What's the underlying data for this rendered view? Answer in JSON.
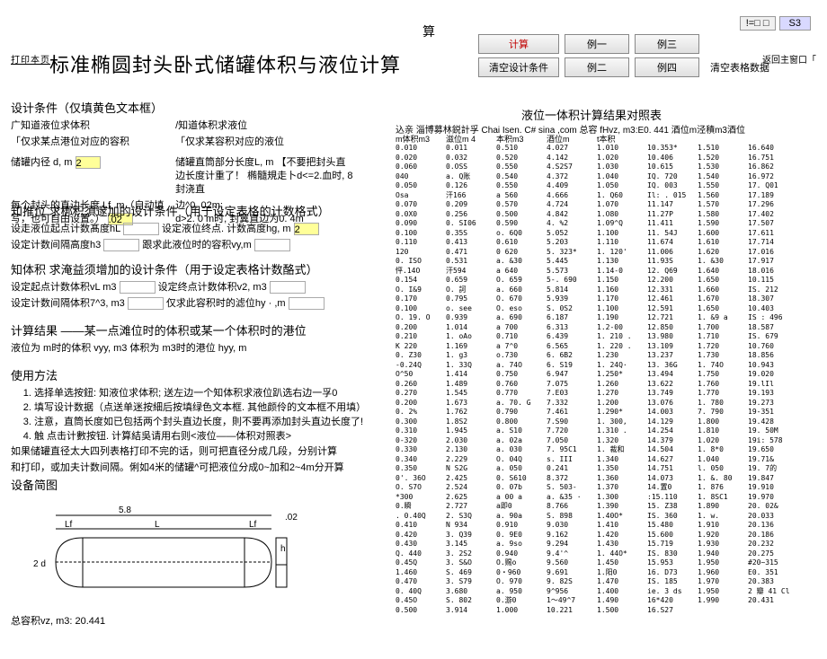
{
  "header": {
    "suan": "算",
    "flag": "!=□ □",
    "s3": "S3",
    "print": "打印本页",
    "title": "标准椭圆封头卧式储罐体积与液位计算",
    "back": "返回主窗口「"
  },
  "buttons": {
    "calc": "计算",
    "ex1": "例一",
    "ex3": "例三",
    "clr1": "清空设计条件",
    "ex2": "例二",
    "ex4": "例四",
    "clr2": "清空表格数据"
  },
  "cond": {
    "hdr": "设计条件（仅填黄色文本框）",
    "c1": "广知道液位求体积",
    "c2": "/知道体积求液位",
    "c3": "「仅求某点港位对应的容积",
    "c4": "「仅求某容积对应的液位",
    "dlabel": "储罐内径 d, m",
    "dval": "2",
    "lf_label": "每个封头的直边长度 Lf, m（自动填写，也可自由设置。）",
    "lf_val": ".02",
    "r1": "储罐直筒部分长度L, m 【不要把封头直边长度计重了！      椭髓規走卜d<=2.血时, 8封浇直",
    "r2": "边^0. 02m;",
    "r3": "d>2. 0 m时, 封翼直边为0. 4m"
  },
  "known_level": {
    "hdr": "知推位       求梆积須邃加的设计条件（用于设定表格的计数格式）",
    "l1": "设走液位起点计数髙度hL",
    "l2": "设定计数间隔高度h3",
    "r1": "设定液位终点. 计数高度hg, m",
    "r1v": "2",
    "r2": "跟求此液位时的容积vy,m"
  },
  "known_vol": {
    "hdr": "知体积      求淹益须增加的设计条件（用于设定表格计数酪式）",
    "l1": "设定起点计数体积vL m3",
    "l2": "设定计数间隔体积7^3, m3",
    "r1": "设定终点计数体积v2, m3",
    "r2": "仅求此容积时的滤位hy · ,m"
  },
  "result": {
    "hdr": "计算结果     ——某一点滩位时的体积或某一个体积时的港位",
    "row": "液位为         m时的体积 vyy, m3                   体积为         m3时的港位 hyy, m"
  },
  "usage": {
    "hdr": "使用方法",
    "i1": "选择单选按鈕: 知液位求体积; 送左边一个知体积求液位趴选右边一孚0",
    "i2": "填写设计数据（点送单迷按細后按填绿色文本框. 其他颜伶的文本框不用填）",
    "i3": "注意，直筒长度如已包括两个封头直边长度，則不要再添加封头直边长度了!",
    "i4": "触 点击计數按钮. 计算結吳请用右则<液位——体积对照表>",
    "n1": "如果储罐直径太大四列表格打印不完的话，则可把直径分成几段，分别计算",
    "n2": "和打印，或加夫计数间隔。俐如4米的储罐^可把液位分成0~加和2~4m分开算"
  },
  "diagram": {
    "hdr": "设备简图",
    "vz": "总容积vz, m3: 20.441"
  },
  "table": {
    "title": "液位一体积计算结果对照表",
    "sub": "込亲 淄博募林鋭計孚 Chai Isen. C#  sina ,com 总容 fHvz, m3:E0. 441 酒位m泾積m3酒位",
    "headers": [
      "m体积m3",
      "滋位m 4",
      "本积m3",
      "酒位m",
      "t本积"
    ],
    "rows": [
      [
        "0.010",
        "0.011",
        "0.510",
        "4.027",
        "1.010",
        "10.353*",
        "1.510",
        "16.640"
      ],
      [
        "0.020",
        "0.032",
        "0.520",
        "4.142",
        "1.020",
        "10.406",
        "1.520",
        "16.751"
      ],
      [
        "0.060",
        "0.OSS",
        "0.550",
        "4.S2S7",
        "1.030",
        "10.615",
        "1.530",
        "16.862"
      ],
      [
        "040",
        "a. Q账",
        "0.540",
        "4.372",
        "1.040",
        "IQ. 720",
        "1.540",
        "16.972"
      ],
      [
        "0.050",
        "0.126",
        "0.550",
        "4.409",
        "1.050",
        "IQ. 003",
        "1.550",
        "17. Q01"
      ],
      [
        "Osa",
        "汗166",
        "a 560",
        "4.666",
        "1. Q60",
        "Il: . 015",
        "1.560",
        "17.189"
      ],
      [
        "0.070",
        "0.209",
        "0.570",
        "4.724",
        "1.070",
        "11.147",
        "1.570",
        "17.296"
      ],
      [
        "0.0X0",
        "0.256",
        "0.500",
        "4.842",
        "1.O80",
        "11.27P",
        "1.580",
        "17.402"
      ],
      [
        "0.090",
        "0. SI06",
        "0.590",
        "4. %2",
        "1.09^Q",
        "11.411",
        "1.590",
        "17.507"
      ],
      [
        "0.100",
        "0.35S",
        "o. 6Q0",
        "5.052",
        "1.100",
        "11. 54J",
        "1.600",
        "17.611"
      ],
      [
        "0.110",
        "0.413",
        "0.610",
        "5.203",
        "1.110",
        "11.674",
        "1.610",
        "17.714"
      ],
      [
        "120",
        "0.471",
        "0 620",
        "5. 323*",
        "1. 120'",
        "11.006",
        "1.620",
        "17.016"
      ],
      [
        "0. ISO",
        "0.531",
        "a. &30",
        "5.445",
        "1.130",
        "11.93S",
        "1. &30",
        "17.917"
      ],
      [
        "怦.14O",
        "汗594",
        "a 640",
        "5.573",
        "1.14-0",
        "12. Q69",
        "1.640",
        "18.016"
      ],
      [
        "0.154",
        "0.659",
        "O. 659",
        "5-. 690",
        "1.150",
        "12.200",
        "1.650",
        "10.115"
      ],
      [
        "O. I&9",
        "O. 訶",
        "a. 660",
        "5.814",
        "1.160",
        "12.331",
        "1.660",
        "IS. 212"
      ],
      [
        "0.170",
        "0.795",
        "O. 670",
        "5.939",
        "1.170",
        "12.461",
        "1.670",
        "18.307"
      ],
      [
        "0.100",
        "o. see",
        "O. eso",
        "S. 0S2",
        "1.100",
        "12.591",
        "1.650",
        "10.403"
      ],
      [
        "O. 19. O",
        "0.939",
        "a. 690",
        "6.187",
        "1.190",
        "12.721",
        "1. &9 a",
        "IS : 496"
      ],
      [
        "0.200",
        "1.014",
        "a 700",
        "6.313",
        "1.2-00",
        "12.850",
        "1.700",
        "18.587"
      ],
      [
        "0.210",
        "1. oAo",
        "0.710",
        "6.439",
        "1. 210 .",
        "13.980",
        "1.710",
        "IS. 679"
      ],
      [
        "K 220",
        "1.169",
        "a 7^0",
        "6.565",
        "1. 220 .",
        "13.109",
        "1.720",
        "10.760"
      ],
      [
        "0. Z30",
        "1. g3",
        "o.730",
        "6. 6B2",
        "1.230",
        "13.237",
        "1.730",
        "18.856"
      ],
      [
        "-0.24Q",
        "1. 33Q",
        "a. 74O",
        "6. S19",
        "1. 24Q·",
        "13. 36G",
        "1. 74O",
        "10.943"
      ],
      [
        "O^50",
        "1.414",
        "0.750",
        "6.947",
        "1.250*",
        "13.494",
        "1.750",
        "19.020"
      ],
      [
        "0.260",
        "1.489",
        "0.760",
        "7.075",
        "1.260",
        "13.622",
        "1.760",
        "19.lIl"
      ],
      [
        "0.270",
        "1.545",
        "0.770",
        "7.E03",
        "1.270",
        "13.749",
        "1.770",
        "19.193"
      ],
      [
        "0.200",
        "1.673",
        "a. 70. G",
        "7.332",
        "1.200",
        "13.076",
        "1. 780",
        "19.273"
      ],
      [
        "0. 2%",
        "1.762",
        "0.790",
        "7.461",
        "1.290*",
        "14.003",
        "7. 790",
        "19-351"
      ],
      [
        "0.300",
        "1.8S2",
        "0.800",
        "7.S90",
        "1. 300,",
        "14.129",
        "1.800",
        "19.428"
      ],
      [
        "0.310",
        "1.945",
        "a. S10",
        "7.720",
        "1.310 .",
        "14.254",
        "1.810",
        "19. 50M"
      ],
      [
        "0-320",
        "2.030",
        "a. 02a",
        "7.050",
        "1.320",
        "14.379",
        "1.020",
        "19i: 578"
      ],
      [
        "0.330",
        "2.130",
        "a. 030",
        "7. 95C1",
        "1. 裁和",
        "14.504",
        "1. 8*0",
        "19.650"
      ],
      [
        "0.340",
        "2.229",
        "O. 04Q",
        "s. III",
        "1.340",
        "14.627",
        "1.040",
        "19.71&"
      ],
      [
        "0.350",
        "N S2G",
        "a. 050",
        "0.241",
        "1.350",
        "14.751",
        "l. 050",
        "19. 7的"
      ],
      [
        "0'. 36O",
        "2.425",
        "0. S610",
        "8.372",
        "1.360",
        "14.073",
        "1. &. 80",
        "19.847"
      ],
      [
        "O. S7O",
        "2.524",
        "0. 07b",
        "S. 503-",
        "1.370",
        "14.置0",
        "1. 876",
        "19.910"
      ],
      [
        "*300",
        "2.625",
        "a 00 a",
        "a. &35  ·",
        "1.300",
        ":15.110",
        "1. 8SC1",
        "19.970"
      ],
      [
        "0.瞬",
        "2.727",
        "a即0",
        "8.766",
        "1.390",
        "15. Z38",
        "1.890",
        "20. 02&"
      ],
      [
        ". 0.40Q",
        "2. S3Q",
        "a. 90a",
        "S. 898",
        "1.40O*",
        "IS. 360",
        "1. w.",
        "20.033"
      ],
      [
        "0.410",
        "N 934",
        "0.910",
        "9.030",
        "1.410",
        "15.480",
        "1.910",
        "20.136"
      ],
      [
        "0.420",
        "3. Q39",
        "0. 9E0",
        "9.162",
        "1.420",
        "15.600",
        "1.920",
        "20.186"
      ],
      [
        "0.430",
        "3.145",
        "a. 9so",
        "9.294",
        "1.430",
        "15.719",
        "1.930",
        "20.232"
      ],
      [
        "Q. 440",
        "3. 2S2",
        "0.940",
        "9.4'^",
        "1. 44O*",
        "IS. 830",
        "1.940",
        "20.275"
      ],
      [
        "0.45Q",
        "3. S&O",
        "O.赐o",
        "9.560",
        "1.450",
        "15.953",
        "1.950",
        "#20~315"
      ],
      [
        "1.460",
        "S. 469",
        "0・960",
        "9.691",
        "1.阳0",
        "16. D73",
        "1.960",
        "E0. 351"
      ],
      [
        "0.470",
        "3. S79",
        "O. 970",
        "9. 82S",
        "1.470",
        "IS. 185",
        "1.970",
        "20.383"
      ],
      [
        "0. 40Q",
        "3.680",
        "a. 950",
        "9^956",
        "1.400",
        "ie. 3 ds",
        "1.950",
        "2 瓣 41 Cl"
      ],
      [
        "0.45O",
        "S. 802",
        "0.游0",
        "1〜49^7",
        "1.490",
        "16*420",
        "1.990",
        "20.431"
      ],
      [
        "0.500",
        "3.914",
        "1.000",
        "10.221",
        "1.500",
        "16.S27",
        "",
        ""
      ]
    ]
  }
}
